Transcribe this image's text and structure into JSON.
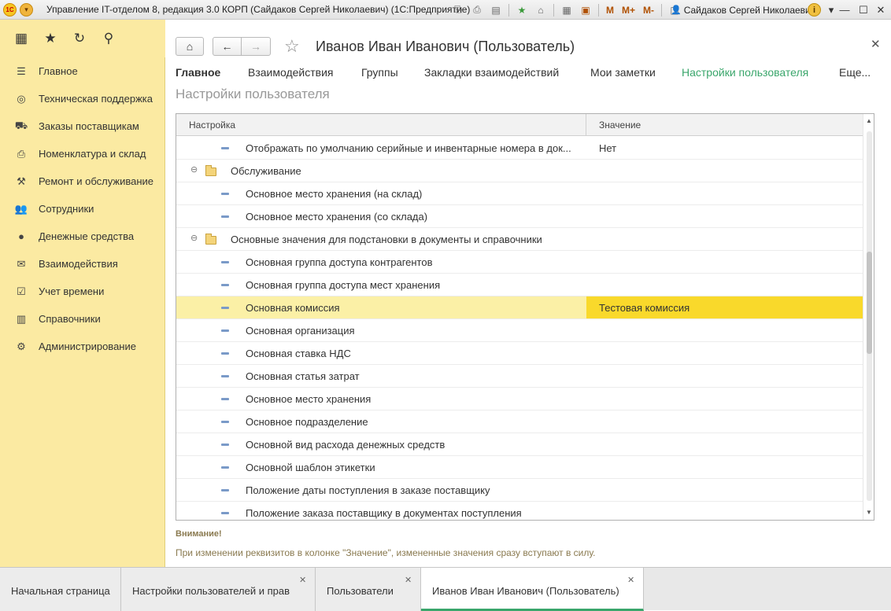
{
  "window": {
    "title": "Управление IT-отделом 8, редакция 3.0 КОРП (Сайдаков Сергей Николаевич)  (1С:Предприятие)",
    "user": "Сайдаков Сергей Николаевич",
    "logo_text": "1C",
    "m_label": "M",
    "m_plus_label": "M+",
    "m_minus_label": "M-"
  },
  "sidebar": {
    "items": [
      {
        "label": "Главное",
        "icon": "menu-lines-icon"
      },
      {
        "label": "Техническая поддержка",
        "icon": "lifebuoy-icon"
      },
      {
        "label": "Заказы поставщикам",
        "icon": "truck-icon"
      },
      {
        "label": "Номенклатура и склад",
        "icon": "printer-icon"
      },
      {
        "label": "Ремонт и обслуживание",
        "icon": "wrench-icon"
      },
      {
        "label": "Сотрудники",
        "icon": "people-icon"
      },
      {
        "label": "Денежные средства",
        "icon": "money-bag-icon"
      },
      {
        "label": "Взаимодействия",
        "icon": "envelope-icon"
      },
      {
        "label": "Учет времени",
        "icon": "calendar-check-icon"
      },
      {
        "label": "Справочники",
        "icon": "books-icon"
      },
      {
        "label": "Администрирование",
        "icon": "gear-icon"
      }
    ]
  },
  "form": {
    "title": "Иванов Иван Иванович (Пользователь)",
    "tabs": [
      {
        "label": "Главное"
      },
      {
        "label": "Взаимодействия"
      },
      {
        "label": "Группы"
      },
      {
        "label": "Закладки взаимодействий"
      },
      {
        "label": "Мои заметки"
      },
      {
        "label": "Настройки пользователя"
      },
      {
        "label": "Еще..."
      }
    ],
    "section_title": "Настройки пользователя",
    "table": {
      "col_setting": "Настройка",
      "col_value": "Значение",
      "rows": [
        {
          "name": "Отображать по умолчанию серийные и инвентарные номера в док...",
          "value": "Нет"
        },
        {
          "name": "Обслуживание",
          "value": ""
        },
        {
          "name": "Основное место хранения (на склад)",
          "value": ""
        },
        {
          "name": "Основное место хранения (со склада)",
          "value": ""
        },
        {
          "name": "Основные значения для подстановки в документы и справочники",
          "value": ""
        },
        {
          "name": "Основная группа доступа контрагентов",
          "value": ""
        },
        {
          "name": "Основная группа доступа мест хранения",
          "value": ""
        },
        {
          "name": "Основная комиссия",
          "value": "Тестовая комиссия"
        },
        {
          "name": "Основная организация",
          "value": ""
        },
        {
          "name": "Основная ставка НДС",
          "value": ""
        },
        {
          "name": "Основная статья затрат",
          "value": ""
        },
        {
          "name": "Основное место хранения",
          "value": ""
        },
        {
          "name": "Основное подразделение",
          "value": ""
        },
        {
          "name": "Основной вид расхода денежных средств",
          "value": ""
        },
        {
          "name": "Основной шаблон этикетки",
          "value": ""
        },
        {
          "name": "Положение даты поступления в заказе поставщику",
          "value": ""
        },
        {
          "name": "Положение заказа поставщику в документах поступления",
          "value": ""
        }
      ]
    },
    "warning_title": "Внимание!",
    "warning_text": "При изменении реквизитов в колонке \"Значение\", измененные значения сразу вступают в силу."
  },
  "bottom_tabs": [
    {
      "label": "Начальная страница"
    },
    {
      "label": "Настройки пользователей и прав"
    },
    {
      "label": "Пользователи"
    },
    {
      "label": "Иванов Иван Иванович (Пользователь)"
    }
  ],
  "colors": {
    "sidebar_bg": "#fbeaa2",
    "selected_row": "#fbf0a6",
    "selected_value": "#f9d92b",
    "accent_green": "#3aa66b"
  }
}
